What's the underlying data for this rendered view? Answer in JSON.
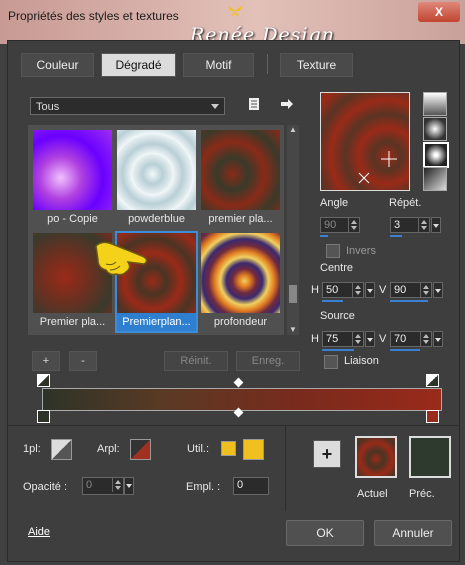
{
  "window": {
    "title": "Propriétés des styles et textures",
    "brand": "Renée Design",
    "close_label": "X"
  },
  "tabs": [
    {
      "label": "Couleur",
      "active": false
    },
    {
      "label": "Dégradé",
      "active": true
    },
    {
      "label": "Motif",
      "active": false
    },
    {
      "label": "Texture",
      "active": false
    }
  ],
  "library": {
    "filter_value": "Tous",
    "thumbnails": [
      {
        "caption": "po - Copie"
      },
      {
        "caption": "powderblue"
      },
      {
        "caption": "premier pla..."
      },
      {
        "caption": "Premier pla..."
      },
      {
        "caption": "Premierplan...",
        "selected": true
      },
      {
        "caption": "profondeur"
      }
    ],
    "add_label": "+",
    "remove_label": "-",
    "reset_label": "Réinit.",
    "save_label": "Enreg."
  },
  "settings": {
    "angle_label": "Angle",
    "angle_value": "90",
    "repeat_label": "Répét.",
    "repeat_value": "3",
    "invert_label": "Invers",
    "center_label": "Centre",
    "center_h_label": "H",
    "center_h": "50",
    "center_v_label": "V",
    "center_v": "90",
    "source_label": "Source",
    "source_h_label": "H",
    "source_h": "75",
    "source_v_label": "V",
    "source_v": "70",
    "link_label": "Liaison"
  },
  "bottom": {
    "1pl_label": "1pl:",
    "arpl_label": "Arpl:",
    "util_label": "Util.:",
    "opacity_label": "Opacité :",
    "opacity_value": "0",
    "empl_label": "Empl. :",
    "empl_value": "0",
    "current_label": "Actuel",
    "previous_label": "Préc.",
    "add_label": "+"
  },
  "footer": {
    "help_label": "Aide",
    "ok_label": "OK",
    "cancel_label": "Annuler"
  },
  "colors": {
    "accent": "#2f7fd0",
    "previous_swatch": "#2f3a2f",
    "util_swatch": "#f0c020",
    "gradient_start": "#2d3328",
    "gradient_end": "#9a2a1a"
  }
}
